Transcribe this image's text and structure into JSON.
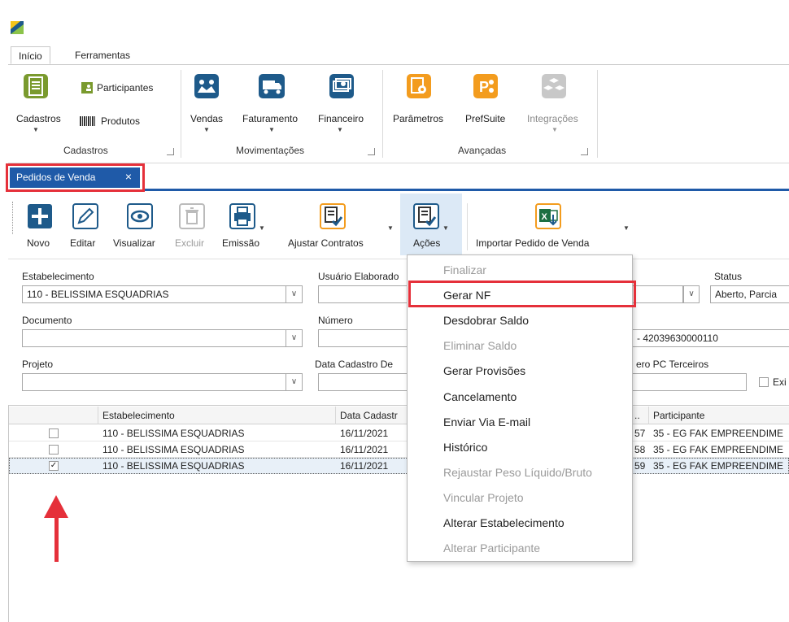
{
  "ribbon": {
    "tabs": [
      {
        "label": "Início"
      },
      {
        "label": "Ferramentas"
      }
    ],
    "groups": {
      "cadastros": {
        "label": "Cadastros",
        "cadastros_button": "Cadastros",
        "participantes_button": "Participantes",
        "produtos_button": "Produtos"
      },
      "movimentacoes": {
        "label": "Movimentações",
        "vendas_button": "Vendas",
        "faturamento_button": "Faturamento",
        "financeiro_button": "Financeiro"
      },
      "avancadas": {
        "label": "Avançadas",
        "parametros_button": "Parâmetros",
        "prefsuite_button": "PrefSuite",
        "integracoes_button": "Integrações"
      }
    }
  },
  "doc_tab": {
    "label": "Pedidos de Venda",
    "close": "×"
  },
  "toolbar": {
    "novo": "Novo",
    "editar": "Editar",
    "visualizar": "Visualizar",
    "excluir": "Excluir",
    "emissao": "Emissão",
    "ajustar_contratos": "Ajustar Contratos",
    "acoes": "Ações",
    "importar": "Importar Pedido de Venda"
  },
  "filters": {
    "estabelecimento_label": "Estabelecimento",
    "estabelecimento_value": "110 - BELISSIMA ESQUADRIAS",
    "usuario_label": "Usuário Elaborado",
    "status_label": "Status",
    "status_value": "Aberto, Parcia",
    "documento_label": "Documento",
    "numero_label": "Número",
    "participante_value": "- 42039630000110",
    "projeto_label": "Projeto",
    "data_cadastro_label": "Data Cadastro De",
    "pc_terceiros_label": "ero PC Terceiros",
    "exibir_label": "Exi"
  },
  "grid": {
    "columns": [
      "Estabelecimento",
      "Data Cadastr",
      "..",
      "Participante"
    ],
    "rows": [
      {
        "checked": false,
        "estabelecimento": "110 - BELISSIMA ESQUADRIAS",
        "data": "16/11/2021",
        "num": "57",
        "participante": "35 - EG FAK EMPREENDIME"
      },
      {
        "checked": false,
        "estabelecimento": "110 - BELISSIMA ESQUADRIAS",
        "data": "16/11/2021",
        "num": "58",
        "participante": "35 - EG FAK EMPREENDIME"
      },
      {
        "checked": true,
        "estabelecimento": "110 - BELISSIMA ESQUADRIAS",
        "data": "16/11/2021",
        "num": "59",
        "participante": "35 - EG FAK EMPREENDIME"
      }
    ]
  },
  "acoes_menu": {
    "items": [
      {
        "label": "Finalizar",
        "enabled": false
      },
      {
        "label": "Gerar NF",
        "enabled": true
      },
      {
        "label": "Desdobrar Saldo",
        "enabled": true
      },
      {
        "label": "Eliminar Saldo",
        "enabled": false
      },
      {
        "label": "Gerar Provisões",
        "enabled": true
      },
      {
        "label": "Cancelamento",
        "enabled": true
      },
      {
        "label": "Enviar Via E-mail",
        "enabled": true
      },
      {
        "label": "Histórico",
        "enabled": true
      },
      {
        "label": "Rejaustar Peso Líquido/Bruto",
        "enabled": false
      },
      {
        "label": "Vincular Projeto",
        "enabled": false
      },
      {
        "label": "Alterar Estabelecimento",
        "enabled": true
      },
      {
        "label": "Alterar Participante",
        "enabled": false
      }
    ]
  },
  "colors": {
    "accent_blue": "#1f5aa8",
    "highlight_red": "#e5303a",
    "cadastros_icon": "#7a9a2e",
    "movimentacoes_icon": "#1e5a8a",
    "avancadas_icon": "#f39c1e"
  }
}
